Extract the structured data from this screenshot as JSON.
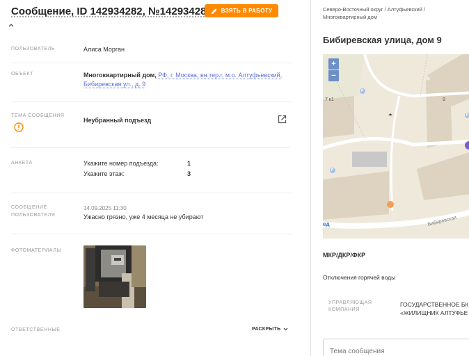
{
  "header": {
    "title": "Сообщение, ID 142934282, №142934282",
    "take_button": "ВЗЯТЬ В РАБОТУ"
  },
  "fields": {
    "user": {
      "label": "ПОЛЬЗОВАТЕЛЬ",
      "value": "Алиса Морган"
    },
    "object": {
      "label": "ОБЪЕКТ",
      "type": "Многоквартирный дом,",
      "address_line1": "РФ, г. Москва, вн.тер.г. м.о. Алтуфьевский,",
      "address_line2": "Бибиревская ул., д. 9"
    },
    "topic": {
      "label": "ТЕМА СООБЩЕНИЯ",
      "value": "Неубранный подъезд"
    },
    "survey": {
      "label": "АНКЕТА",
      "rows": [
        {
          "question": "Укажите номер подъезда:",
          "answer": "1"
        },
        {
          "question": "Укажите этаж:",
          "answer": "3"
        }
      ]
    },
    "message": {
      "label_line1": "СООБЩЕНИЕ",
      "label_line2": "ПОЛЬЗОВАТЕЛЯ",
      "date": "14.09.2025 11:30",
      "text": "Ужасно грязно, уже 4 месяца не убирают"
    },
    "photos": {
      "label": "ФОТОМАТЕРИАЛЫ"
    },
    "responsible": {
      "label": "ОТВЕТСТВЕННЫЕ",
      "expand": "РАСКРЫТЬ"
    }
  },
  "right": {
    "breadcrumb_line1": "Северо-Восточный округ / Алтуфьевский /",
    "breadcrumb_line2": "Многоквартирный дом",
    "title": "Бибиревская улица, дом 9",
    "map": {
      "zoom_in": "+",
      "zoom_out": "−",
      "labels": {
        "building_7k1": "7 к1",
        "building_9": "9",
        "street": "Бибиревская",
        "edge": "ед",
        "p1": "P",
        "p2": "P",
        "p3": "P"
      }
    },
    "mkr": "МКР/ДКР/ФКР",
    "hot_water": "Отключения горячей воды",
    "mgmt": {
      "label_line1": "УПРАВЛЯЮЩАЯ",
      "label_line2": "КОМПАНИЯ",
      "value_line1": "ГОСУДАРСТВЕННОЕ БК",
      "value_line2": "«ЖИЛИЩНИК АЛТУФЬЕ"
    },
    "subject_placeholder": "Тема сообщения"
  },
  "colors": {
    "accent": "#ff8a00",
    "link": "#5b6fd6",
    "map_zoom": "#6d8fc7"
  }
}
